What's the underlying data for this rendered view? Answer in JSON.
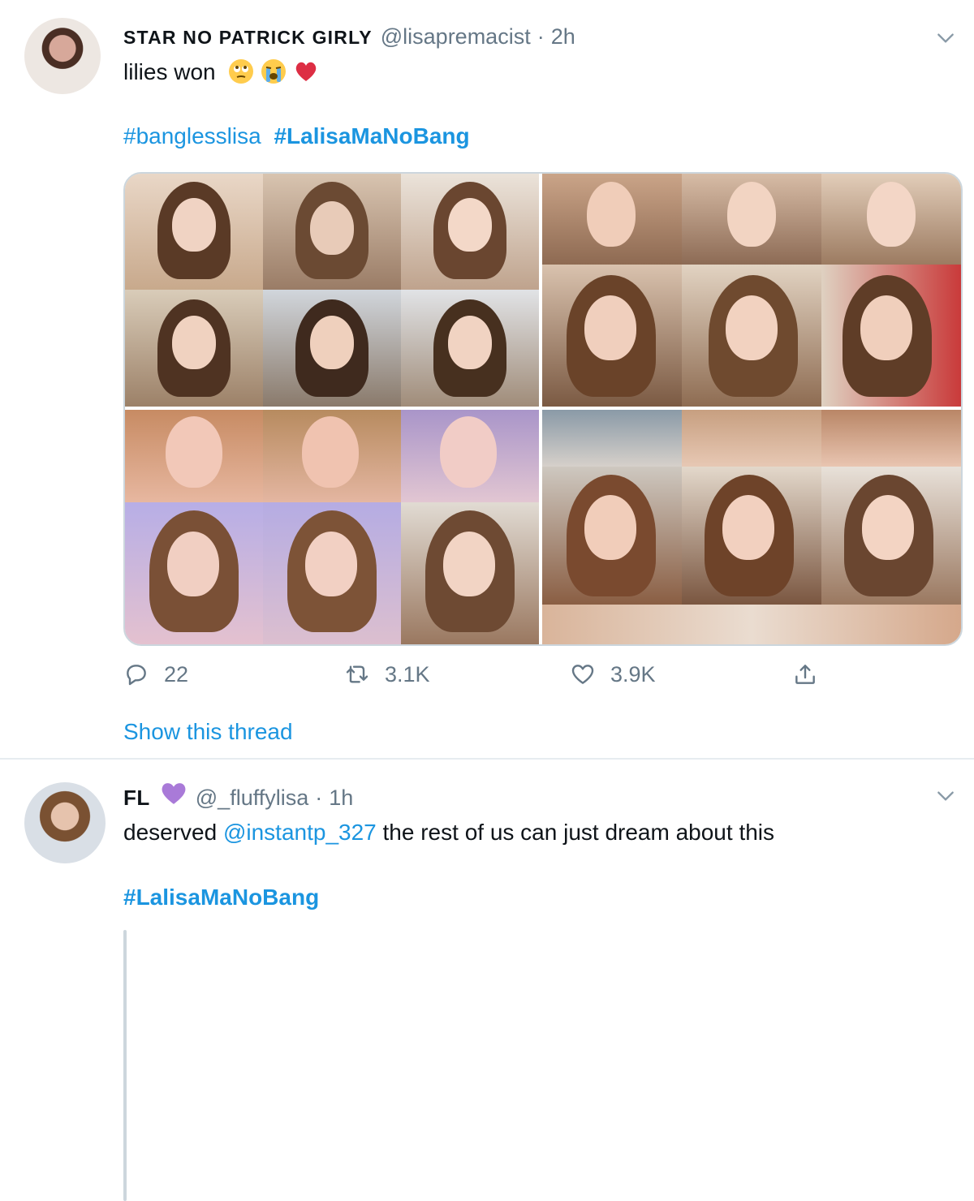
{
  "tweet1": {
    "display_name": "STAR NO PATRICK GIRLY",
    "handle": "@lisapremacist",
    "separator": "·",
    "time": "2h",
    "text": "lilies won",
    "hashtags": [
      "#banglesslisa",
      "#LalisaMaNoBang"
    ],
    "reply_count": "22",
    "retweet_count": "3.1K",
    "like_count": "3.9K",
    "show_thread": "Show this thread"
  },
  "tweet2": {
    "display_name": "FL",
    "handle": "@_fluffylisa",
    "separator": "·",
    "time": "1h",
    "text_before": "deserved ",
    "mention": "@instantp_327",
    "text_after": " the rest of us can just dream about this",
    "hashtag": "#LalisaMaNoBang"
  },
  "colors": {
    "link": "#1b95e0",
    "muted": "#657786",
    "verified_heart": "#a97ad8",
    "divider": "#e6ecf0"
  },
  "icons": {
    "reply": "reply-icon",
    "retweet": "retweet-icon",
    "like": "heart-icon",
    "share": "share-icon",
    "menu": "chevron-down-icon"
  }
}
